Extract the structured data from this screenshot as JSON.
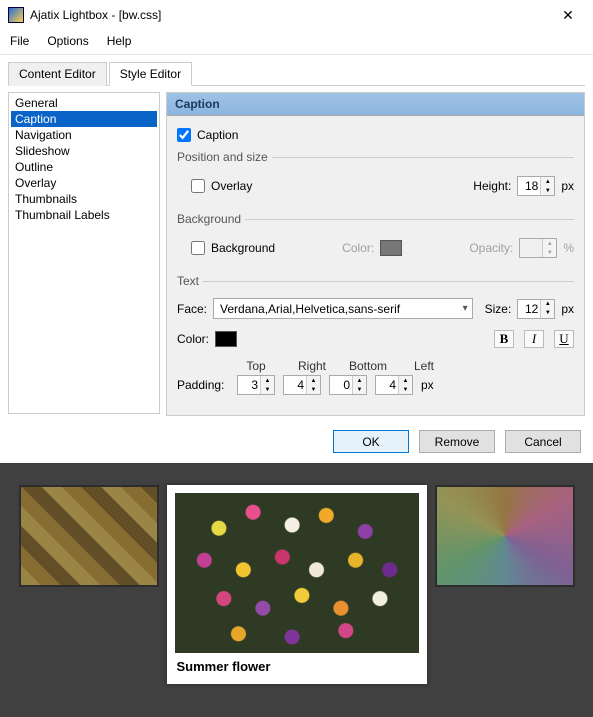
{
  "window": {
    "title": "Ajatix Lightbox - [bw.css]"
  },
  "menu": {
    "file": "File",
    "options": "Options",
    "help": "Help"
  },
  "tabs": {
    "content": "Content Editor",
    "style": "Style Editor"
  },
  "sidebar": {
    "items": [
      "General",
      "Caption",
      "Navigation",
      "Slideshow",
      "Outline",
      "Overlay",
      "Thumbnails",
      "Thumbnail Labels"
    ],
    "selected": 1
  },
  "panel": {
    "header": "Caption",
    "caption_chk_label": "Caption",
    "caption_checked": true,
    "pos": {
      "legend": "Position and size",
      "overlay_label": "Overlay",
      "overlay_checked": false,
      "height_label": "Height:",
      "height_value": "18",
      "px": "px"
    },
    "bg": {
      "legend": "Background",
      "bg_label": "Background",
      "bg_checked": false,
      "color_label": "Color:",
      "opacity_label": "Opacity:",
      "opacity_value": "",
      "pct": "%"
    },
    "text": {
      "legend": "Text",
      "face_label": "Face:",
      "face_value": "Verdana,Arial,Helvetica,sans-serif",
      "size_label": "Size:",
      "size_value": "12",
      "px": "px",
      "color_label": "Color:",
      "top": "Top",
      "right": "Right",
      "bottom": "Bottom",
      "left": "Left",
      "padding_label": "Padding:",
      "pad_top": "3",
      "pad_right": "4",
      "pad_bottom": "0",
      "pad_left": "4"
    }
  },
  "buttons": {
    "ok": "OK",
    "remove": "Remove",
    "cancel": "Cancel"
  },
  "preview": {
    "caption": "Summer flower"
  }
}
